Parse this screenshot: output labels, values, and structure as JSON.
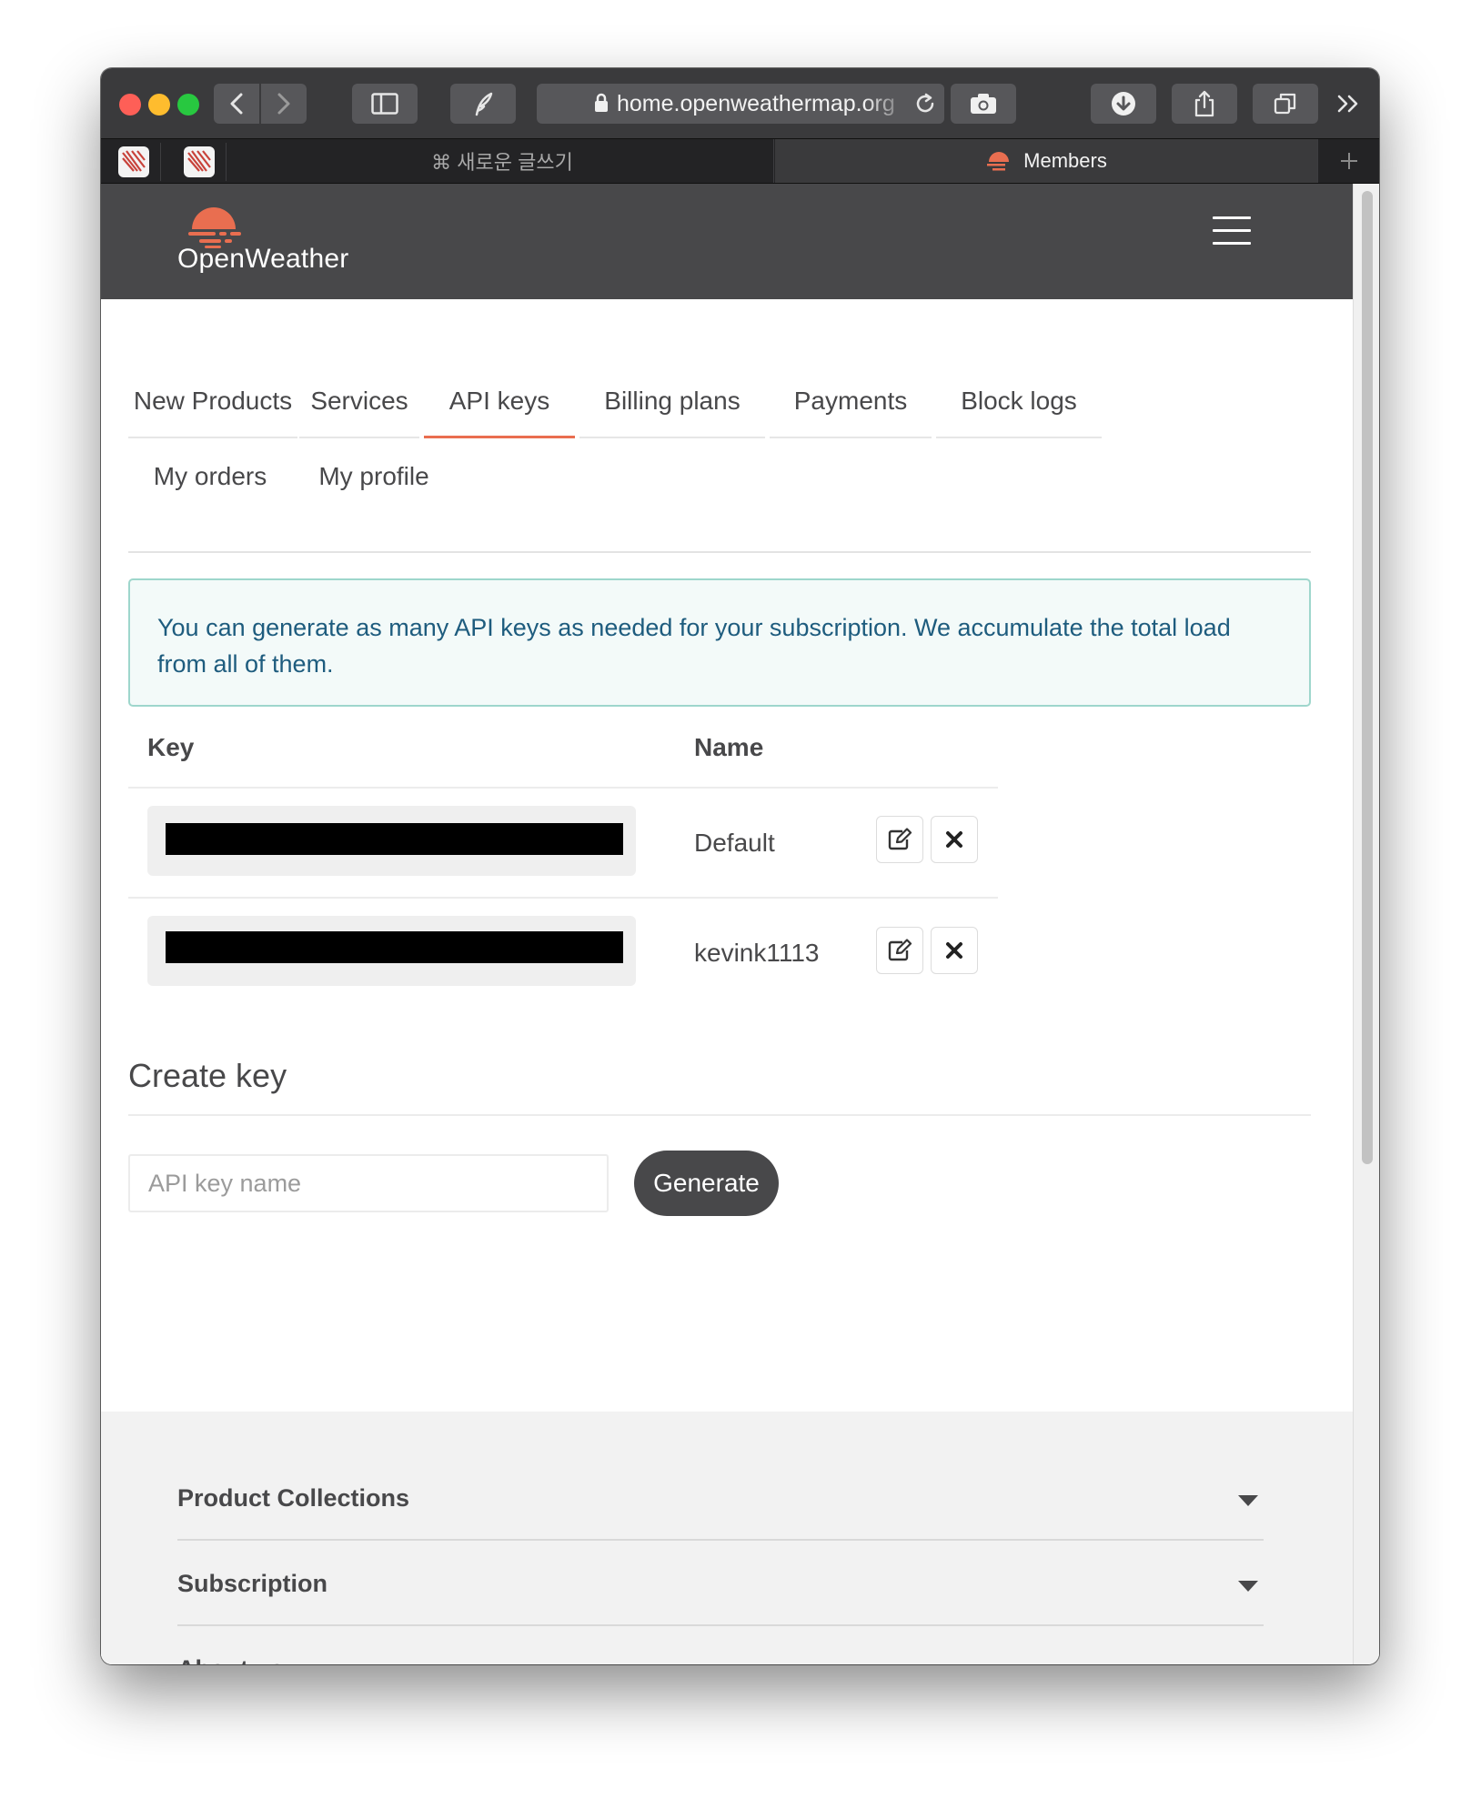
{
  "browser": {
    "address": "home.openweathermap.org",
    "tabs": [
      {
        "label": "⌘ 새로운 글쓰기"
      },
      {
        "label": "Members"
      }
    ]
  },
  "site": {
    "brand": "OpenWeather"
  },
  "nav": {
    "items": [
      {
        "label": "New Products"
      },
      {
        "label": "Services"
      },
      {
        "label": "API keys",
        "active": true
      },
      {
        "label": "Billing plans"
      },
      {
        "label": "Payments"
      },
      {
        "label": "Block logs"
      },
      {
        "label": "My orders"
      },
      {
        "label": "My profile"
      }
    ]
  },
  "alert": {
    "text": "You can generate as many API keys as needed for your subscription. We accumulate the total load from all of them."
  },
  "keys_table": {
    "headers": {
      "key": "Key",
      "name": "Name"
    },
    "rows": [
      {
        "name": "Default"
      },
      {
        "name": "kevink1113"
      }
    ]
  },
  "create": {
    "title": "Create key",
    "placeholder": "API key name",
    "button": "Generate"
  },
  "footer": {
    "sections": [
      {
        "label": "Product Collections"
      },
      {
        "label": "Subscription"
      },
      {
        "label": "About us"
      }
    ]
  },
  "colors": {
    "accent": "#e96e50",
    "header_bg": "#48484a",
    "alert_text": "#1e5c7e",
    "alert_border": "#9ed6cc"
  }
}
